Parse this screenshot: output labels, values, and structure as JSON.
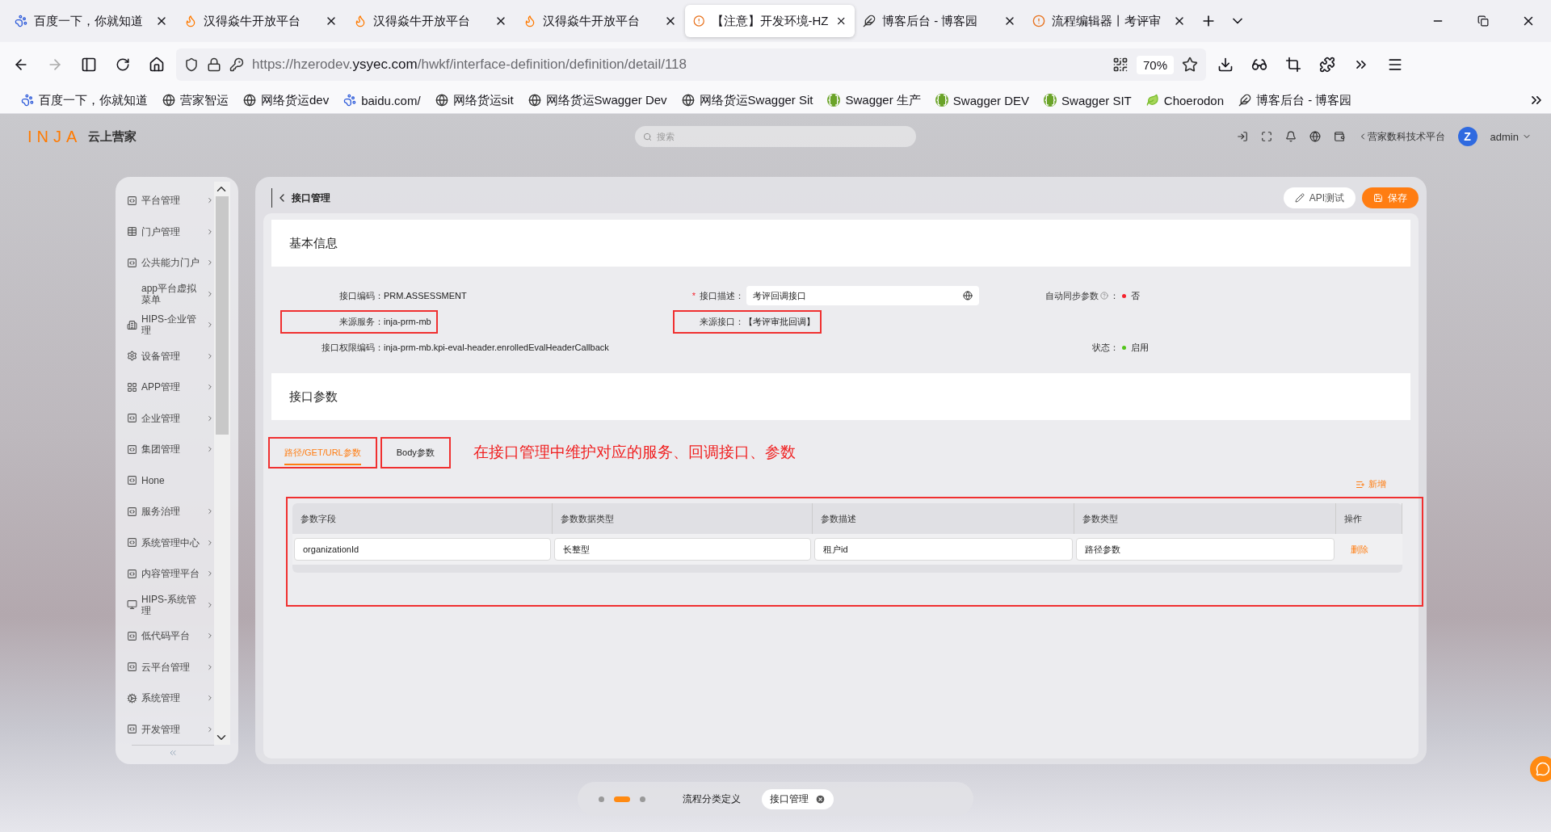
{
  "browser": {
    "tabs": [
      {
        "title": "百度一下，你就知道",
        "kind": "paw",
        "selected": false
      },
      {
        "title": "汉得焱牛开放平台",
        "kind": "flame",
        "selected": false
      },
      {
        "title": "汉得焱牛开放平台",
        "kind": "flame",
        "selected": false
      },
      {
        "title": "汉得焱牛开放平台",
        "kind": "flame",
        "selected": false
      },
      {
        "title": "【注意】开发环境-HZ",
        "kind": "alert",
        "selected": true
      },
      {
        "title": "博客后台 - 博客园",
        "kind": "feather",
        "selected": false
      },
      {
        "title": "流程编辑器丨考评审",
        "kind": "alert",
        "selected": false
      }
    ],
    "url": {
      "prefix": "https://hzerodev.",
      "domain": "ysyec.com",
      "path": "/hwkf/interface-definition/definition/detail/118"
    },
    "zoom": "70%",
    "bookmarks": [
      {
        "label": "百度一下，你就知道",
        "kind": "paw"
      },
      {
        "label": "营家智运",
        "kind": "globe"
      },
      {
        "label": "网络货运dev",
        "kind": "globe"
      },
      {
        "label": "baidu.com/",
        "kind": "paw"
      },
      {
        "label": "网络货运sit",
        "kind": "globe"
      },
      {
        "label": "网络货运Swagger Dev",
        "kind": "globe"
      },
      {
        "label": "网络货运Swagger Sit",
        "kind": "globe"
      },
      {
        "label": "Swagger 生产",
        "kind": "braces"
      },
      {
        "label": "Swagger DEV",
        "kind": "braces"
      },
      {
        "label": "Swagger SIT",
        "kind": "braces"
      },
      {
        "label": "Choerodon",
        "kind": "leaf"
      },
      {
        "label": "博客后台 - 博客园",
        "kind": "feather"
      }
    ]
  },
  "app": {
    "logo_mark": "INJA",
    "logo_text": "云上营家",
    "search": {
      "placeholder": "搜索"
    },
    "org": "营家数科技术平台",
    "avatar_letter": "Z",
    "user": "admin"
  },
  "sidebar": {
    "items": [
      {
        "label": "平台管理",
        "kind": "code",
        "arrow": true
      },
      {
        "label": "门户管理",
        "kind": "table",
        "arrow": true
      },
      {
        "label": "公共能力门户",
        "kind": "code",
        "arrow": true
      },
      {
        "label": "app平台虚拟菜单",
        "kind": "none",
        "arrow": true
      },
      {
        "label": "HIPS-企业管理",
        "kind": "building",
        "arrow": true
      },
      {
        "label": "设备管理",
        "kind": "gear",
        "arrow": true
      },
      {
        "label": "APP管理",
        "kind": "grid",
        "arrow": true
      },
      {
        "label": "企业管理",
        "kind": "code",
        "arrow": true
      },
      {
        "label": "集团管理",
        "kind": "code",
        "arrow": true
      },
      {
        "label": "Hone",
        "kind": "code",
        "arrow": false
      },
      {
        "label": "服务治理",
        "kind": "code",
        "arrow": true
      },
      {
        "label": "系统管理中心",
        "kind": "code",
        "arrow": true
      },
      {
        "label": "内容管理平台",
        "kind": "code",
        "arrow": true
      },
      {
        "label": "HIPS-系统管理",
        "kind": "monitor",
        "arrow": true
      },
      {
        "label": "低代码平台",
        "kind": "code",
        "arrow": true
      },
      {
        "label": "云平台管理",
        "kind": "code",
        "arrow": true
      },
      {
        "label": "系统管理",
        "kind": "cog",
        "arrow": true
      },
      {
        "label": "开发管理",
        "kind": "code",
        "arrow": true
      }
    ]
  },
  "page": {
    "title": "接口管理",
    "buttons": [
      {
        "label": "API测试",
        "kind": "default"
      },
      {
        "label": "保存",
        "kind": "primary"
      }
    ],
    "basic": {
      "title": "基本信息",
      "rows": [
        {
          "left": {
            "label": "接口编码：",
            "value": "PRM.ASSESSMENT",
            "kind": "text",
            "annotated": false
          },
          "middle": {
            "required_mark": "*",
            "label": "接口描述：",
            "value": "考评回调接口",
            "kind": "input",
            "annotated": false
          },
          "right": {
            "label": "自动同步参数",
            "help": true,
            "suffix": "：",
            "value": "否",
            "color": "#f5222d",
            "kind": "status",
            "annotated": false
          }
        },
        {
          "left": {
            "label": "来源服务：",
            "value": "inja-prm-mb",
            "kind": "text",
            "annotated": true
          },
          "middle": {
            "label": "来源接口：",
            "value": "【考评审批回调】",
            "kind": "text",
            "annotated": true
          }
        },
        {
          "left": {
            "label": "接口权限编码：",
            "value": "inja-prm-mb.kpi-eval-header.enrolledEvalHeaderCallback",
            "kind": "text",
            "annotated": false
          },
          "right": {
            "label": "状态：",
            "value": "启用",
            "color": "#52c41a",
            "kind": "status",
            "annotated": false
          }
        }
      ]
    },
    "params": {
      "title": "接口参数",
      "tabs": [
        {
          "label": "路径/GET/URL参数",
          "selected": true,
          "annotated": true
        },
        {
          "label": "Body参数",
          "selected": false,
          "annotated": true
        }
      ],
      "annotation": "在接口管理中维护对应的服务、回调接口、参数",
      "add_label": "新增",
      "table": {
        "annotated": true,
        "columns": [
          "参数字段",
          "参数数据类型",
          "参数描述",
          "参数类型",
          "操作"
        ],
        "rows": [
          {
            "cells": [
              "organizationId",
              "长整型",
              "租户id",
              "路径参数"
            ],
            "action": "删除"
          }
        ]
      }
    }
  },
  "dock": {
    "pages": [
      {
        "selected": false
      },
      {
        "selected": true
      },
      {
        "selected": false
      }
    ],
    "tabs": [
      {
        "label": "流程分类定义",
        "selected": false,
        "closable": false
      },
      {
        "label": "接口管理",
        "selected": true,
        "closable": true
      }
    ]
  }
}
